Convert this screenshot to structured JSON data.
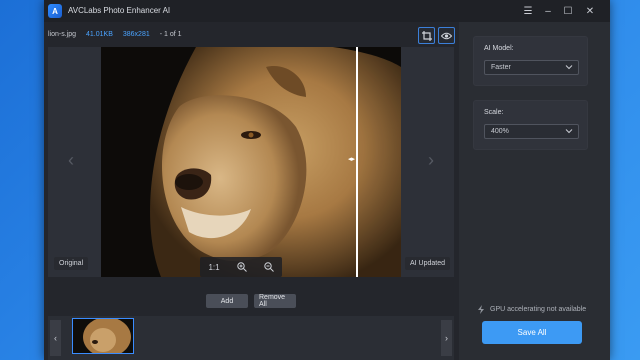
{
  "window": {
    "title": "AVCLabs Photo Enhancer AI",
    "controls": {
      "menu": "☰",
      "minimize": "–",
      "maximize": "☐",
      "close": "✕"
    }
  },
  "file_info": {
    "name": "lion-s.jpg",
    "size": "41.01KB",
    "dimensions": "386x281",
    "count": "- 1 of 1"
  },
  "viewer": {
    "label_original": "Original",
    "label_updated": "AI Updated",
    "zoom_ratio": "1:1",
    "nav_prev": "‹",
    "nav_next": "›"
  },
  "actions": {
    "add": "Add",
    "remove_all": "Remove All"
  },
  "thumb_strip": {
    "prev": "‹",
    "next": "›"
  },
  "settings": {
    "ai_model_label": "AI Model:",
    "ai_model_value": "Faster",
    "scale_label": "Scale:",
    "scale_value": "400%"
  },
  "footer": {
    "gpu_note": "GPU accelerating not available",
    "save_all": "Save All"
  },
  "colors": {
    "accent": "#3d9af4",
    "link": "#4aa3ff",
    "panel": "#2a2d33"
  }
}
